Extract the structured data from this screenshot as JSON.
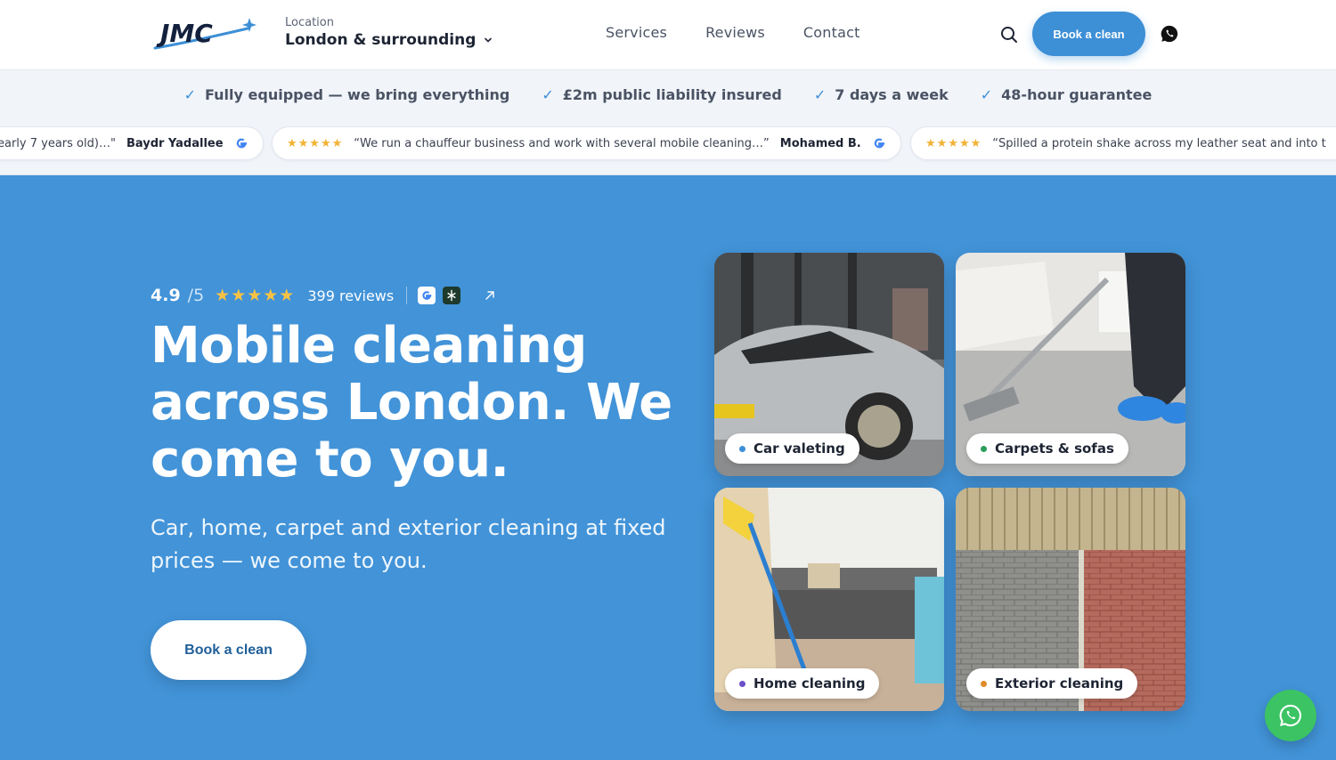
{
  "header": {
    "logo_text": "JMC",
    "location_label": "Location",
    "location_value": "London & surrounding",
    "nav": [
      "Services",
      "Reviews",
      "Contact"
    ],
    "book_label": "Book a clean",
    "icons": {
      "search": "search-icon",
      "whatsapp": "whatsapp-icon",
      "chevron": "chevron-down-icon"
    }
  },
  "features": [
    "Fully equipped — we bring everything",
    "£2m public liability insured",
    "7 days a week",
    "48-hour guarantee"
  ],
  "reviews": [
    {
      "quote": "early 7 years old)…\"",
      "author": "Baydr Yadallee",
      "stars": "★★★★★"
    },
    {
      "quote": "“We run a chauffeur business and work with several mobile cleaning…”",
      "author": "Mohamed B.",
      "stars": "★★★★★"
    },
    {
      "quote": "“Spilled a protein shake across my leather seat and into t",
      "author": "",
      "stars": "★★★★★"
    }
  ],
  "hero": {
    "rating": "4.9",
    "rating_max": "/5",
    "stars": "★★★★★",
    "review_count": "399 reviews",
    "title": "Mobile cleaning across London. We come to you.",
    "subtitle": "Car, home, carpet and exterior cleaning at fixed prices — we come to you.",
    "cta_label": "Book a clean"
  },
  "services": [
    {
      "label": "Car valeting",
      "dot_color": "#3d8fd6"
    },
    {
      "label": "Carpets & sofas",
      "dot_color": "#2e9e5b"
    },
    {
      "label": "Home cleaning",
      "dot_color": "#6c4fc9"
    },
    {
      "label": "Exterior cleaning",
      "dot_color": "#e08a2a"
    }
  ],
  "colors": {
    "brand_blue": "#3d8fd6",
    "hero_bg": "#4293d8",
    "star_gold": "#f7c244",
    "whatsapp_green": "#3cc363"
  }
}
